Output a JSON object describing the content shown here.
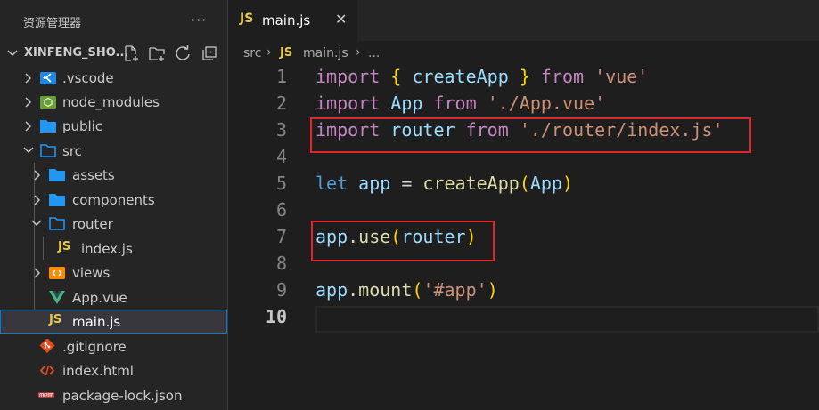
{
  "explorer": {
    "title": "资源管理器",
    "more_icon": "ellipsis-icon",
    "root_label": "XINFENG_SHO...",
    "tools": [
      "new-file-icon",
      "new-folder-icon",
      "refresh-icon",
      "collapse-all-icon"
    ],
    "items": [
      {
        "label": ".vscode",
        "icon": "vscode-folder-icon",
        "type": "folder",
        "expanded": false
      },
      {
        "label": "node_modules",
        "icon": "node-folder-icon",
        "type": "folder",
        "expanded": false
      },
      {
        "label": "public",
        "icon": "folder-icon",
        "type": "folder",
        "expanded": false
      },
      {
        "label": "src",
        "icon": "folder-open-icon",
        "type": "folder",
        "expanded": true
      },
      {
        "label": "assets",
        "icon": "folder-icon",
        "type": "folder",
        "expanded": false
      },
      {
        "label": "components",
        "icon": "folder-icon",
        "type": "folder",
        "expanded": false
      },
      {
        "label": "router",
        "icon": "folder-open-icon",
        "type": "folder",
        "expanded": true
      },
      {
        "label": "index.js",
        "icon": "js-file-icon",
        "type": "file"
      },
      {
        "label": "views",
        "icon": "views-folder-icon",
        "type": "folder",
        "expanded": false
      },
      {
        "label": "App.vue",
        "icon": "vue-file-icon",
        "type": "file"
      },
      {
        "label": "main.js",
        "icon": "js-file-icon",
        "type": "file",
        "selected": true
      },
      {
        "label": ".gitignore",
        "icon": "git-file-icon",
        "type": "file"
      },
      {
        "label": "index.html",
        "icon": "html-file-icon",
        "type": "file"
      },
      {
        "label": "package-lock.json",
        "icon": "npm-file-icon",
        "type": "file"
      }
    ]
  },
  "tab": {
    "icon_text": "JS",
    "label": "main.js",
    "close": "✕"
  },
  "breadcrumb": {
    "folder": "src",
    "icon_text": "JS",
    "file": "main.js",
    "sep": "›",
    "more": "..."
  },
  "editor": {
    "active_line": 10,
    "line_numbers": [
      "1",
      "2",
      "3",
      "4",
      "5",
      "6",
      "7",
      "8",
      "9",
      "10"
    ],
    "lines": [
      [
        {
          "t": "import",
          "c": "kw2"
        },
        {
          "t": " "
        },
        {
          "t": "{",
          "c": "br1"
        },
        {
          "t": " "
        },
        {
          "t": "createApp",
          "c": "var"
        },
        {
          "t": " "
        },
        {
          "t": "}",
          "c": "br1"
        },
        {
          "t": " "
        },
        {
          "t": "from",
          "c": "kw2"
        },
        {
          "t": " "
        },
        {
          "t": "'vue'",
          "c": "str"
        }
      ],
      [
        {
          "t": "import",
          "c": "kw2"
        },
        {
          "t": " "
        },
        {
          "t": "App",
          "c": "var"
        },
        {
          "t": " "
        },
        {
          "t": "from",
          "c": "kw2"
        },
        {
          "t": " "
        },
        {
          "t": "'./App.vue'",
          "c": "str"
        }
      ],
      [
        {
          "t": "import",
          "c": "kw2"
        },
        {
          "t": " "
        },
        {
          "t": "router",
          "c": "var"
        },
        {
          "t": " "
        },
        {
          "t": "from",
          "c": "kw2"
        },
        {
          "t": " "
        },
        {
          "t": "'./router/index.js'",
          "c": "str"
        }
      ],
      [],
      [
        {
          "t": "let",
          "c": "kw"
        },
        {
          "t": " "
        },
        {
          "t": "app",
          "c": "var"
        },
        {
          "t": " = "
        },
        {
          "t": "createApp",
          "c": "fn"
        },
        {
          "t": "(",
          "c": "br1"
        },
        {
          "t": "App",
          "c": "var"
        },
        {
          "t": ")",
          "c": "br1"
        }
      ],
      [],
      [
        {
          "t": "app",
          "c": "var"
        },
        {
          "t": "."
        },
        {
          "t": "use",
          "c": "fn"
        },
        {
          "t": "(",
          "c": "br1"
        },
        {
          "t": "router",
          "c": "var"
        },
        {
          "t": ")",
          "c": "br1"
        }
      ],
      [],
      [
        {
          "t": "app",
          "c": "var"
        },
        {
          "t": "."
        },
        {
          "t": "mount",
          "c": "fn"
        },
        {
          "t": "(",
          "c": "br1"
        },
        {
          "t": "'#app'",
          "c": "str"
        },
        {
          "t": ")",
          "c": "br1"
        }
      ],
      []
    ]
  },
  "colors": {
    "annotation": "#e1252c",
    "js": "#e6c84a",
    "selection_border": "#007fd4"
  }
}
